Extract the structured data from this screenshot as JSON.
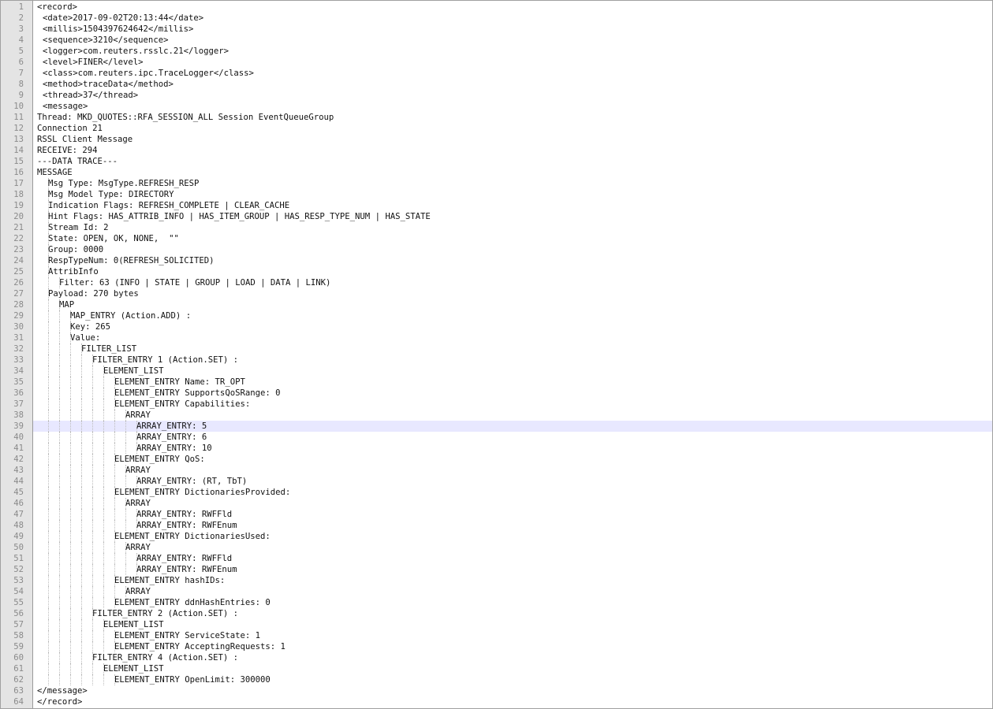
{
  "editor": {
    "current_line": 39,
    "lines": [
      {
        "n": "1",
        "indent": 0,
        "text": "<record>"
      },
      {
        "n": "2",
        "indent": 1,
        "text": "<date>2017-09-02T20:13:44</date>"
      },
      {
        "n": "3",
        "indent": 1,
        "text": "<millis>1504397624642</millis>"
      },
      {
        "n": "4",
        "indent": 1,
        "text": "<sequence>3210</sequence>"
      },
      {
        "n": "5",
        "indent": 1,
        "text": "<logger>com.reuters.rsslc.21</logger>"
      },
      {
        "n": "6",
        "indent": 1,
        "text": "<level>FINER</level>"
      },
      {
        "n": "7",
        "indent": 1,
        "text": "<class>com.reuters.ipc.TraceLogger</class>"
      },
      {
        "n": "8",
        "indent": 1,
        "text": "<method>traceData</method>"
      },
      {
        "n": "9",
        "indent": 1,
        "text": "<thread>37</thread>"
      },
      {
        "n": "10",
        "indent": 1,
        "text": "<message>"
      },
      {
        "n": "11",
        "indent": 0,
        "text": "Thread: MKD_QUOTES::RFA_SESSION_ALL Session EventQueueGroup"
      },
      {
        "n": "12",
        "indent": 0,
        "text": "Connection 21"
      },
      {
        "n": "13",
        "indent": 0,
        "text": "RSSL Client Message"
      },
      {
        "n": "14",
        "indent": 0,
        "text": "RECEIVE: 294"
      },
      {
        "n": "15",
        "indent": 0,
        "text": "---DATA TRACE---"
      },
      {
        "n": "16",
        "indent": 0,
        "text": "MESSAGE"
      },
      {
        "n": "17",
        "indent": 2,
        "text": "Msg Type: MsgType.REFRESH_RESP"
      },
      {
        "n": "18",
        "indent": 2,
        "text": "Msg Model Type: DIRECTORY"
      },
      {
        "n": "19",
        "indent": 2,
        "text": "Indication Flags: REFRESH_COMPLETE | CLEAR_CACHE"
      },
      {
        "n": "20",
        "indent": 2,
        "text": "Hint Flags: HAS_ATTRIB_INFO | HAS_ITEM_GROUP | HAS_RESP_TYPE_NUM | HAS_STATE"
      },
      {
        "n": "21",
        "indent": 2,
        "text": "Stream Id: 2"
      },
      {
        "n": "22",
        "indent": 2,
        "text": "State: OPEN, OK, NONE,  \"\""
      },
      {
        "n": "23",
        "indent": 2,
        "text": "Group: 0000"
      },
      {
        "n": "24",
        "indent": 2,
        "text": "RespTypeNum: 0(REFRESH_SOLICITED)"
      },
      {
        "n": "25",
        "indent": 2,
        "text": "AttribInfo"
      },
      {
        "n": "26",
        "indent": 4,
        "text": "Filter: 63 (INFO | STATE | GROUP | LOAD | DATA | LINK)"
      },
      {
        "n": "27",
        "indent": 2,
        "text": "Payload: 270 bytes"
      },
      {
        "n": "28",
        "indent": 4,
        "text": "MAP"
      },
      {
        "n": "29",
        "indent": 6,
        "text": "MAP_ENTRY (Action.ADD) :"
      },
      {
        "n": "30",
        "indent": 6,
        "text": "Key: 265"
      },
      {
        "n": "31",
        "indent": 6,
        "text": "Value:"
      },
      {
        "n": "32",
        "indent": 8,
        "text": "FILTER_LIST"
      },
      {
        "n": "33",
        "indent": 10,
        "text": "FILTER_ENTRY 1 (Action.SET) :"
      },
      {
        "n": "34",
        "indent": 12,
        "text": "ELEMENT_LIST"
      },
      {
        "n": "35",
        "indent": 14,
        "text": "ELEMENT_ENTRY Name: TR_OPT"
      },
      {
        "n": "36",
        "indent": 14,
        "text": "ELEMENT_ENTRY SupportsQoSRange: 0"
      },
      {
        "n": "37",
        "indent": 14,
        "text": "ELEMENT_ENTRY Capabilities:"
      },
      {
        "n": "38",
        "indent": 16,
        "text": "ARRAY"
      },
      {
        "n": "39",
        "indent": 18,
        "text": "ARRAY_ENTRY: 5"
      },
      {
        "n": "40",
        "indent": 18,
        "text": "ARRAY_ENTRY: 6"
      },
      {
        "n": "41",
        "indent": 18,
        "text": "ARRAY_ENTRY: 10"
      },
      {
        "n": "42",
        "indent": 14,
        "text": "ELEMENT_ENTRY QoS:"
      },
      {
        "n": "43",
        "indent": 16,
        "text": "ARRAY"
      },
      {
        "n": "44",
        "indent": 18,
        "text": "ARRAY_ENTRY: (RT, TbT)"
      },
      {
        "n": "45",
        "indent": 14,
        "text": "ELEMENT_ENTRY DictionariesProvided:"
      },
      {
        "n": "46",
        "indent": 16,
        "text": "ARRAY"
      },
      {
        "n": "47",
        "indent": 18,
        "text": "ARRAY_ENTRY: RWFFld"
      },
      {
        "n": "48",
        "indent": 18,
        "text": "ARRAY_ENTRY: RWFEnum"
      },
      {
        "n": "49",
        "indent": 14,
        "text": "ELEMENT_ENTRY DictionariesUsed:"
      },
      {
        "n": "50",
        "indent": 16,
        "text": "ARRAY"
      },
      {
        "n": "51",
        "indent": 18,
        "text": "ARRAY_ENTRY: RWFFld"
      },
      {
        "n": "52",
        "indent": 18,
        "text": "ARRAY_ENTRY: RWFEnum"
      },
      {
        "n": "53",
        "indent": 14,
        "text": "ELEMENT_ENTRY hashIDs:"
      },
      {
        "n": "54",
        "indent": 16,
        "text": "ARRAY"
      },
      {
        "n": "55",
        "indent": 14,
        "text": "ELEMENT_ENTRY ddnHashEntries: 0"
      },
      {
        "n": "56",
        "indent": 10,
        "text": "FILTER_ENTRY 2 (Action.SET) :"
      },
      {
        "n": "57",
        "indent": 12,
        "text": "ELEMENT_LIST"
      },
      {
        "n": "58",
        "indent": 14,
        "text": "ELEMENT_ENTRY ServiceState: 1"
      },
      {
        "n": "59",
        "indent": 14,
        "text": "ELEMENT_ENTRY AcceptingRequests: 1"
      },
      {
        "n": "60",
        "indent": 10,
        "text": "FILTER_ENTRY 4 (Action.SET) :"
      },
      {
        "n": "61",
        "indent": 12,
        "text": "ELEMENT_LIST"
      },
      {
        "n": "62",
        "indent": 14,
        "text": "ELEMENT_ENTRY OpenLimit: 300000"
      },
      {
        "n": "63",
        "indent": 0,
        "text": "</message>"
      },
      {
        "n": "64",
        "indent": 0,
        "text": "</record>"
      }
    ]
  }
}
